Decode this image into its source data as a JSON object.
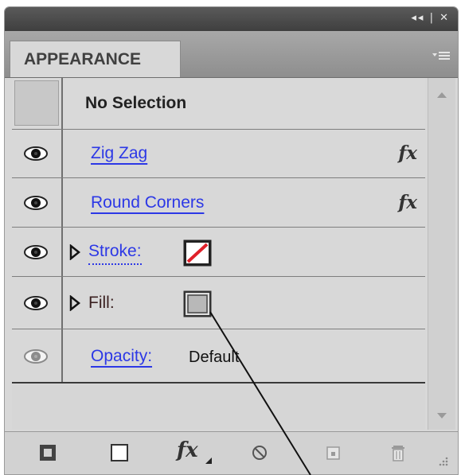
{
  "panel": {
    "tab_label": "APPEARANCE",
    "title_controls": "◂◂ | ✕"
  },
  "rows": [
    {
      "label": "No Selection"
    },
    {
      "label": "Zig Zag",
      "fx": "fx"
    },
    {
      "label": "Round Corners",
      "fx": "fx"
    },
    {
      "label": "Stroke:"
    },
    {
      "label": "Fill:"
    },
    {
      "label": "Opacity:",
      "value": "Default"
    }
  ],
  "bottom_toolbar": {
    "fx_label": "fx"
  },
  "colors": {
    "link_blue": "#2c38e6",
    "stroke_none_red": "#e0202a"
  },
  "icons": [
    "eye-icon",
    "disclosure-triangle-icon",
    "stroke-none-swatch",
    "fill-swatch",
    "panel-menu-icon",
    "scroll-up-arrow",
    "scroll-down-arrow",
    "add-new-stroke-icon",
    "add-new-fill-icon",
    "add-new-effect-icon",
    "clear-appearance-icon",
    "duplicate-item-icon",
    "delete-item-icon",
    "resize-grip-icon"
  ]
}
